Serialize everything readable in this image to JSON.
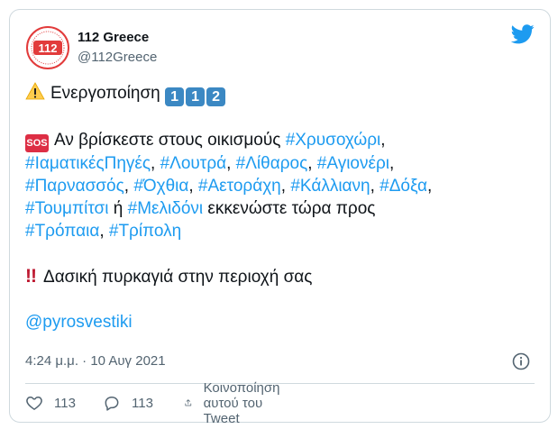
{
  "author": {
    "name": "112 Greece",
    "handle": "@112Greece",
    "avatar_text": "112"
  },
  "tweet": {
    "line1_text": "Ενεργοποίηση",
    "keycaps": [
      "1",
      "1",
      "2"
    ],
    "sos_label": "SOS",
    "intro": "Αν βρίσκεστε στους οικισμούς",
    "hashtags": [
      "#Χρυσοχώρι",
      "#ΙαματικέςΠηγές",
      "#Λουτρά",
      "#Λίθαρος",
      "#Αγιονέρι",
      "#Παρνασσός",
      "#Όχθια",
      "#Αετοράχη",
      "#Κάλλιανη",
      "#Δόξα",
      "#Τουμπίτσι",
      "#Μελιδόνι",
      "#Τρόπαια",
      "#Τρίπολη"
    ],
    "or_word": "ή",
    "evacuate_text": "εκκενώστε τώρα προς",
    "warning_text": "Δασική πυρκαγιά στην περιοχή σας",
    "mention": "@pyrosvestiki"
  },
  "meta": {
    "time": "4:24 μ.μ.",
    "separator": " · ",
    "date": "10 Αυγ 2021"
  },
  "actions": {
    "likes": "113",
    "replies": "113",
    "share_label": "Κοινοποίηση αυτού του Tweet"
  },
  "colors": {
    "link": "#1d9bf0",
    "muted": "#536471",
    "like": "#536471"
  }
}
